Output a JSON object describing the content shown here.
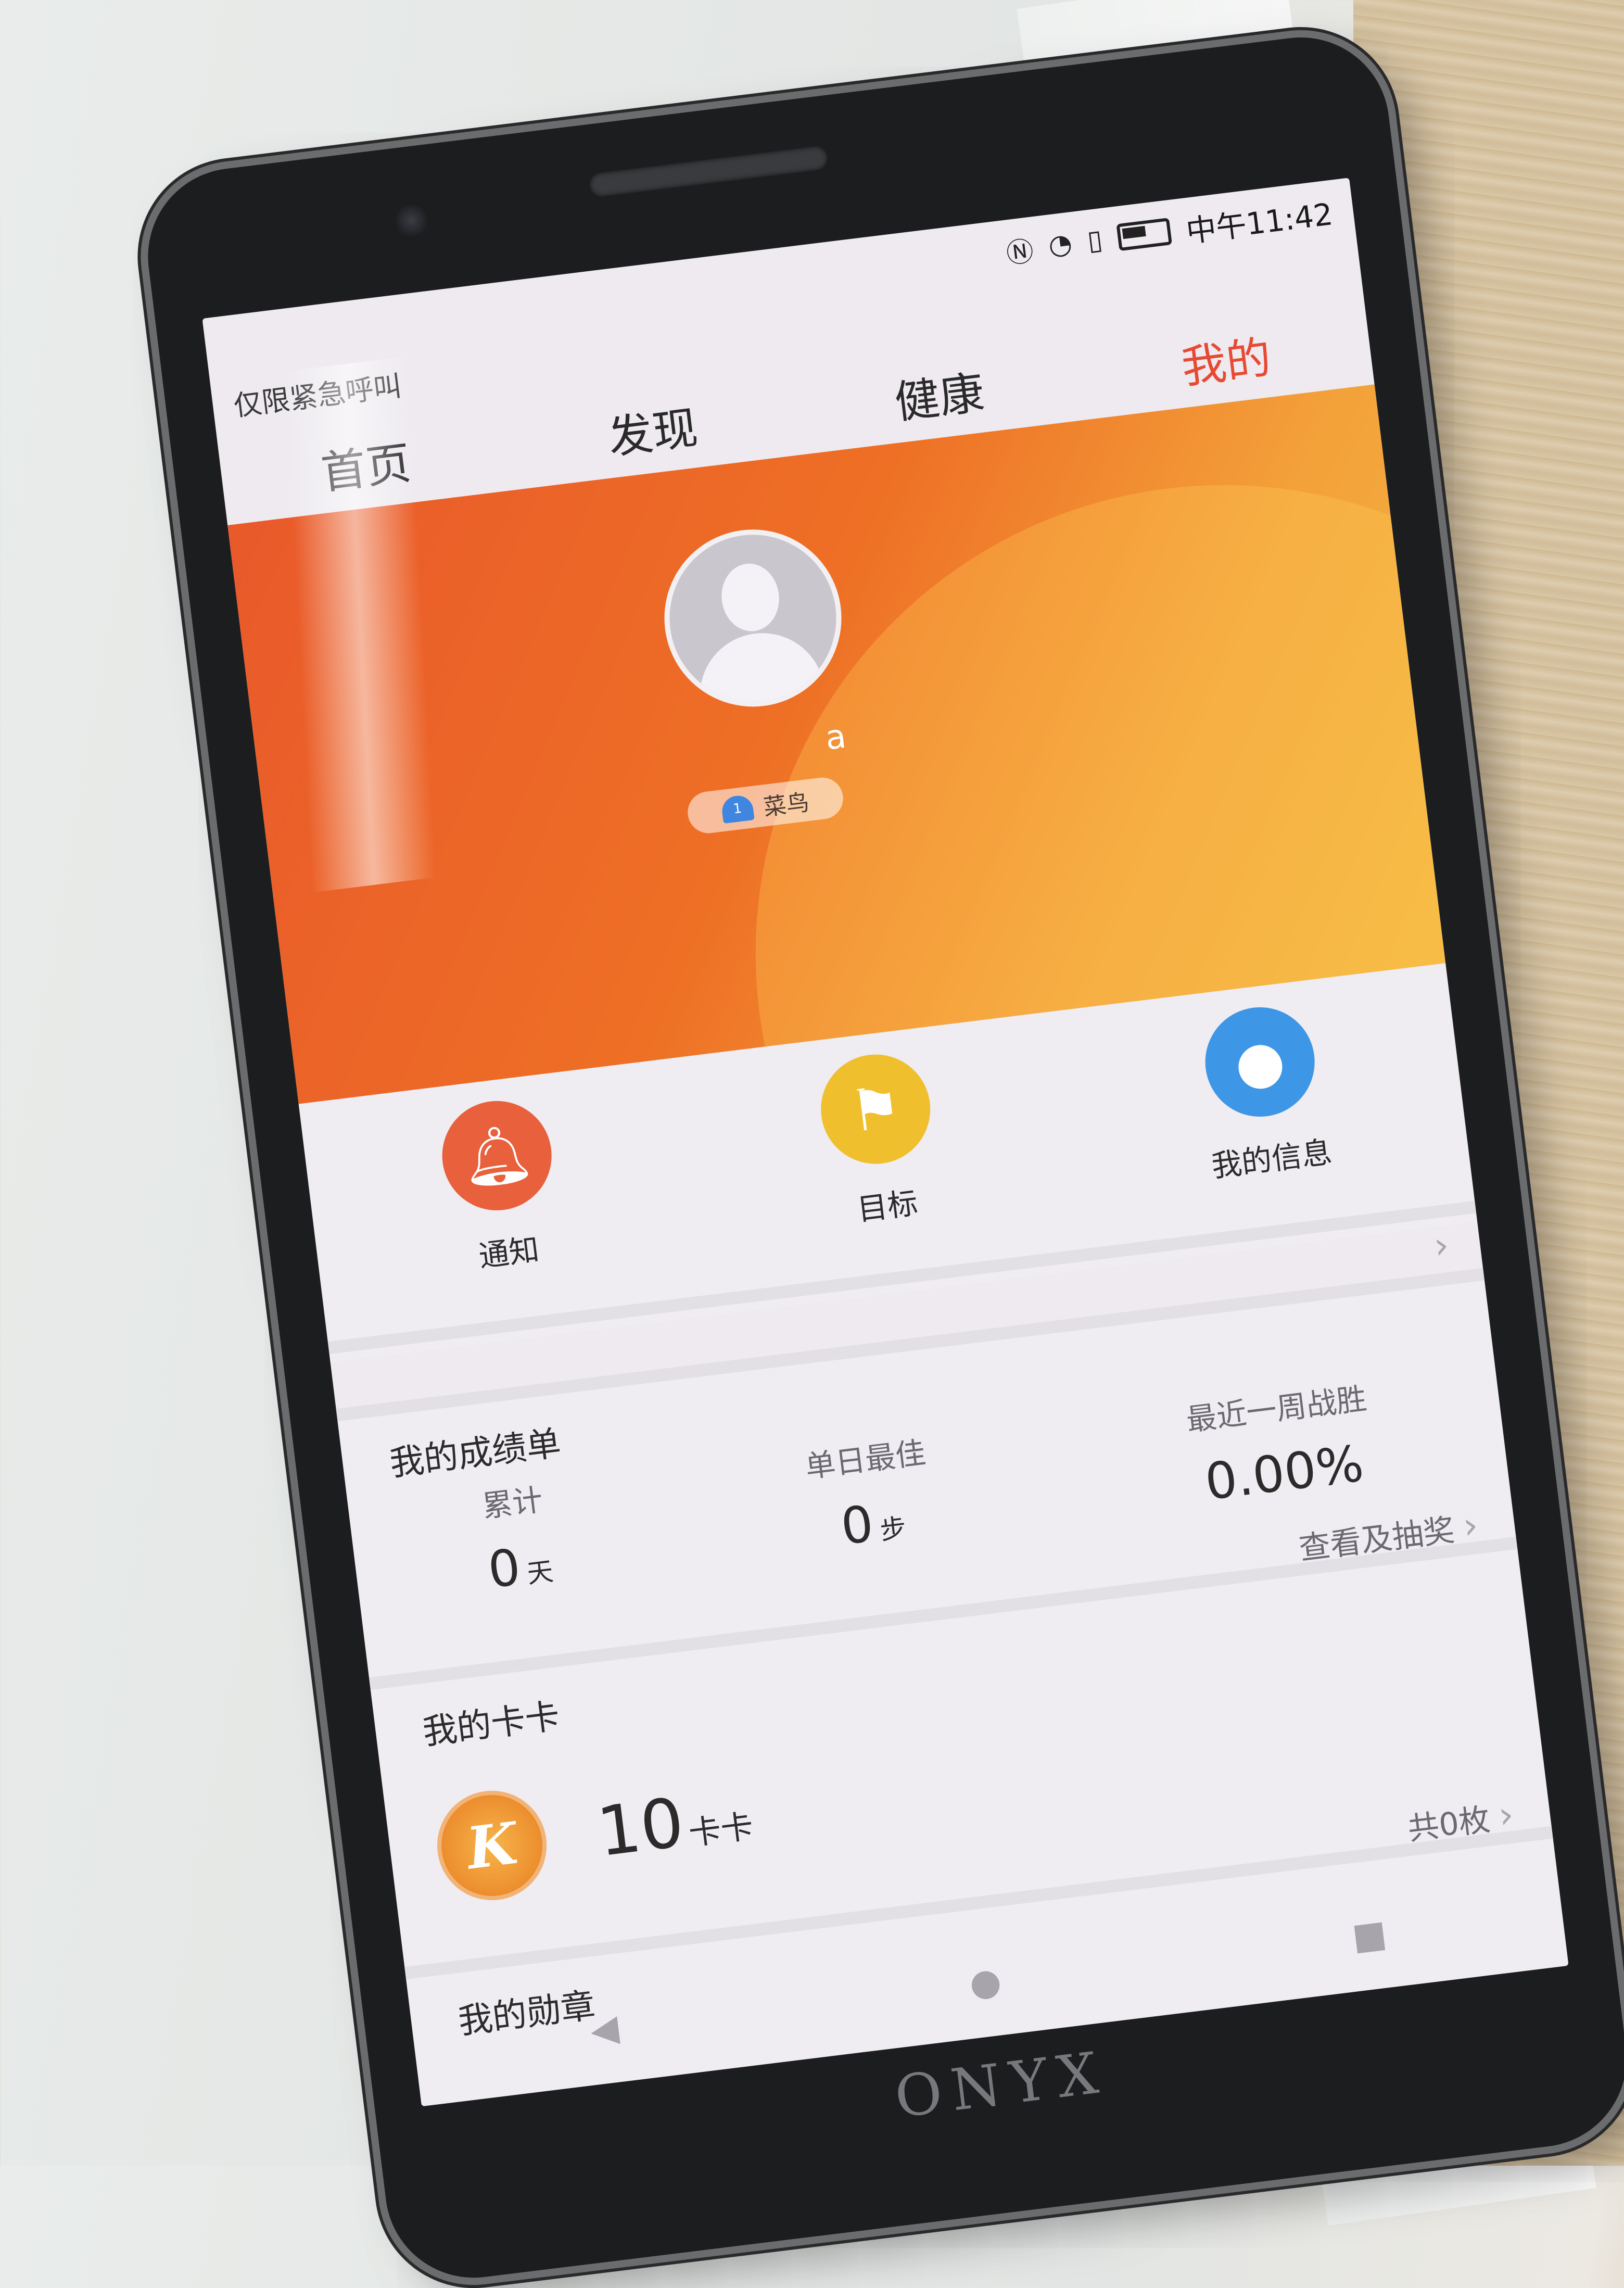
{
  "status_bar": {
    "time": "中午11:42",
    "icons": [
      "nfc-icon",
      "wifi-icon",
      "sim-icon",
      "battery-icon"
    ]
  },
  "emergency_text": "仅限紧急呼叫",
  "tabs": [
    {
      "label": "首页"
    },
    {
      "label": "发现"
    },
    {
      "label": "健康"
    },
    {
      "label": "我的",
      "active": true
    }
  ],
  "profile": {
    "username": "a",
    "level_number": "1",
    "level_name": "菜鸟"
  },
  "quick_actions": [
    {
      "label": "通知",
      "icon": "bell-icon",
      "color": "#e8603c"
    },
    {
      "label": "目标",
      "icon": "flag-icon",
      "color": "#f0bf2e"
    },
    {
      "label": "我的信息",
      "icon": "user-icon",
      "color": "#3d96e6"
    }
  ],
  "report_card": {
    "title": "我的成绩单",
    "stats": [
      {
        "label": "累计",
        "value": "0",
        "unit": "天"
      },
      {
        "label": "单日最佳",
        "value": "0",
        "unit": "步"
      },
      {
        "label": "最近一周战胜",
        "value": "0.00%",
        "unit": ""
      }
    ],
    "link": "查看及抽奖"
  },
  "kaka": {
    "title": "我的卡卡",
    "coin_letter": "K",
    "value": "10",
    "unit": "卡卡",
    "count_link": "共0枚"
  },
  "medals": {
    "title": "我的勋章"
  },
  "brand": "ONYX",
  "colors": {
    "accent": "#e74a33",
    "hero_start": "#e9592b",
    "hero_end": "#f4b53e"
  }
}
